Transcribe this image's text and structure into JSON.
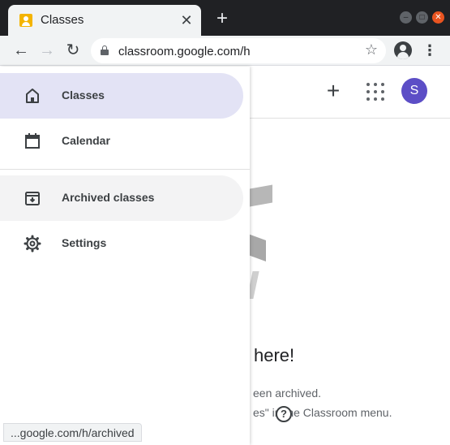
{
  "browser": {
    "tab": {
      "title": "Classes",
      "close_glyph": "✕"
    },
    "new_tab_glyph": "+",
    "window_controls": {
      "minimize": "–",
      "maximize": "□",
      "close": "✕"
    },
    "nav": {
      "back": "←",
      "forward": "→",
      "reload": "↻"
    },
    "url": "classroom.google.com/h",
    "bookmark_glyph": "☆",
    "menu_glyph": "⋮"
  },
  "header": {
    "add_glyph": "+",
    "avatar_letter": "S",
    "accent_color": "#5c4ec6"
  },
  "drawer": {
    "items": [
      {
        "label": "Classes",
        "icon": "home-icon",
        "state": "active"
      },
      {
        "label": "Calendar",
        "icon": "calendar-icon",
        "state": "normal"
      },
      {
        "label": "Archived classes",
        "icon": "archive-icon",
        "state": "hover"
      },
      {
        "label": "Settings",
        "icon": "gear-icon",
        "state": "normal"
      }
    ]
  },
  "main": {
    "empty_title": "here!",
    "empty_line1": "een archived.",
    "empty_line2": "es\" in the Classroom menu.",
    "help_glyph": "?"
  },
  "status_bar": "...google.com/h/archived"
}
